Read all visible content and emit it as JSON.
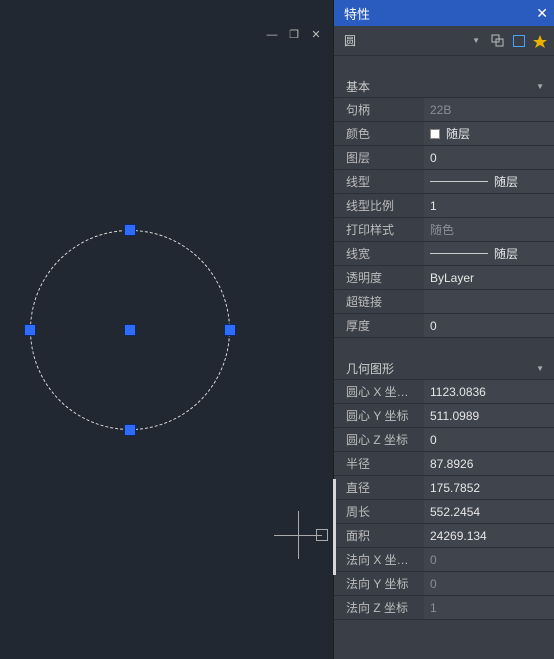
{
  "panel": {
    "title": "特性"
  },
  "selector": {
    "object_type": "圆"
  },
  "sections": {
    "basic_title": "基本",
    "geom_title": "几何图形"
  },
  "labels": {
    "handle": "句柄",
    "color": "颜色",
    "layer": "图层",
    "linetype": "线型",
    "linetype_scale": "线型比例",
    "plot_style": "打印样式",
    "lineweight": "线宽",
    "transparency": "透明度",
    "hyperlink": "超链接",
    "thickness": "厚度",
    "center_x": "圆心 X 坐…",
    "center_y": "圆心 Y 坐标",
    "center_z": "圆心 Z 坐标",
    "radius": "半径",
    "diameter": "直径",
    "circumference": "周长",
    "area": "面积",
    "normal_x": "法向 X 坐…",
    "normal_y": "法向 Y 坐标",
    "normal_z": "法向 Z 坐标"
  },
  "values": {
    "handle": "22B",
    "color_name": "随层",
    "layer": "0",
    "linetype_suffix": "随层",
    "linetype_scale": "1",
    "plot_style": "随色",
    "lineweight_suffix": "随层",
    "transparency": "ByLayer",
    "hyperlink": "",
    "thickness": "0",
    "center_x": "1123.0836",
    "center_y": "511.0989",
    "center_z": "0",
    "radius": "87.8926",
    "diameter": "175.7852",
    "circumference": "552.2454",
    "area": "24269.134",
    "normal_x": "0",
    "normal_y": "0",
    "normal_z": "1"
  }
}
